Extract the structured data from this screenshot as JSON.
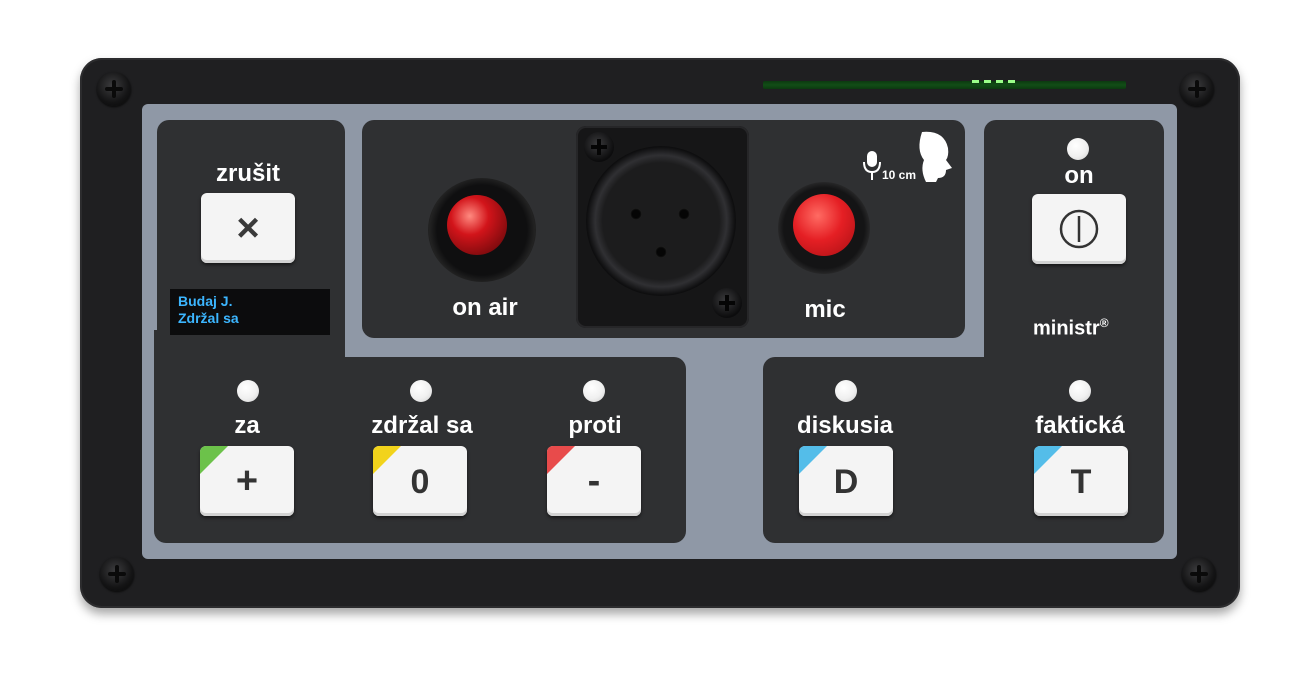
{
  "device": {
    "brand_text": "ministr",
    "brand_mark": "®",
    "mic_distance": "10 cm"
  },
  "cancel": {
    "label": "zrušit",
    "key_glyph": "×"
  },
  "display": {
    "line1": "Budaj J.",
    "line2": "Zdržal sa"
  },
  "center": {
    "on_air_label": "on air",
    "mic_label": "mic"
  },
  "power": {
    "label": "on",
    "key_glyph": "power-icon"
  },
  "votes": [
    {
      "label": "za",
      "key": "+",
      "color": "#6cc24a"
    },
    {
      "label": "zdržal sa",
      "key": "0",
      "color": "#f2d31b"
    },
    {
      "label": "proti",
      "key": "-",
      "color": "#e84b4b"
    }
  ],
  "requests": [
    {
      "label": "diskusia",
      "key": "D",
      "color": "#54bde9"
    },
    {
      "label": "faktická",
      "key": "T",
      "color": "#54bde9"
    }
  ],
  "colors": {
    "on_air_led": "#c8141a",
    "mic_button": "#e51f24",
    "display_text": "#3cb6ff"
  }
}
